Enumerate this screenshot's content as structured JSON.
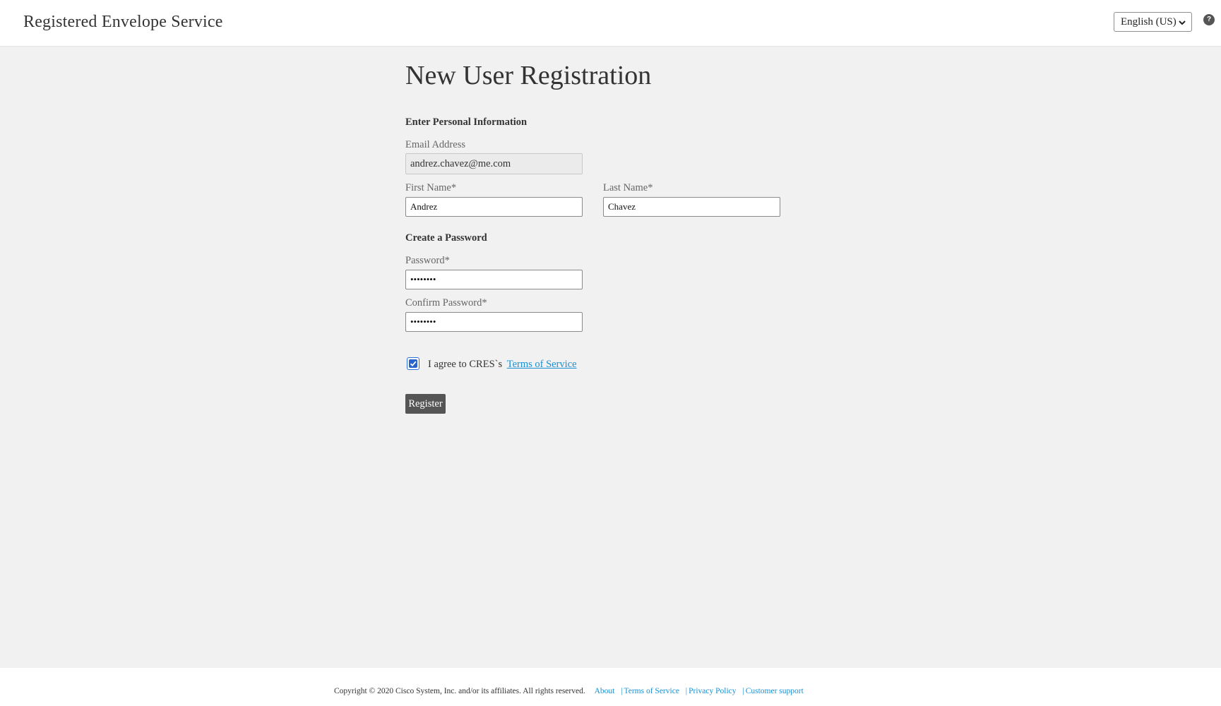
{
  "header": {
    "app_title": "Registered Envelope Service",
    "language": "English (US)",
    "help_symbol": "?"
  },
  "main": {
    "page_title": "New User Registration",
    "personal_section": "Enter Personal Information",
    "email_label": "Email Address",
    "email_value": "andrez.chavez@me.com",
    "first_name_label": "First Name*",
    "first_name_value": "Andrez",
    "last_name_label": "Last Name*",
    "last_name_value": "Chavez",
    "password_section": "Create a Password",
    "password_label": "Password*",
    "password_value": "••••••••",
    "confirm_label": "Confirm Password*",
    "confirm_value": "••••••••",
    "agree_text": "I agree to CRES`s",
    "terms_link": "Terms of Service",
    "agree_checked": true,
    "register_label": "Register"
  },
  "footer": {
    "copyright": "Copyright © 2020 Cisco System, Inc. and/or its affiliates. All rights reserved.",
    "links": [
      "About",
      "Terms of Service",
      "Privacy Policy",
      "Customer support"
    ],
    "separator": "|"
  },
  "colors": {
    "link": "#1a8fd2",
    "button": "#555555",
    "background": "#f1f1f1",
    "checkbox": "#2a63c9"
  }
}
